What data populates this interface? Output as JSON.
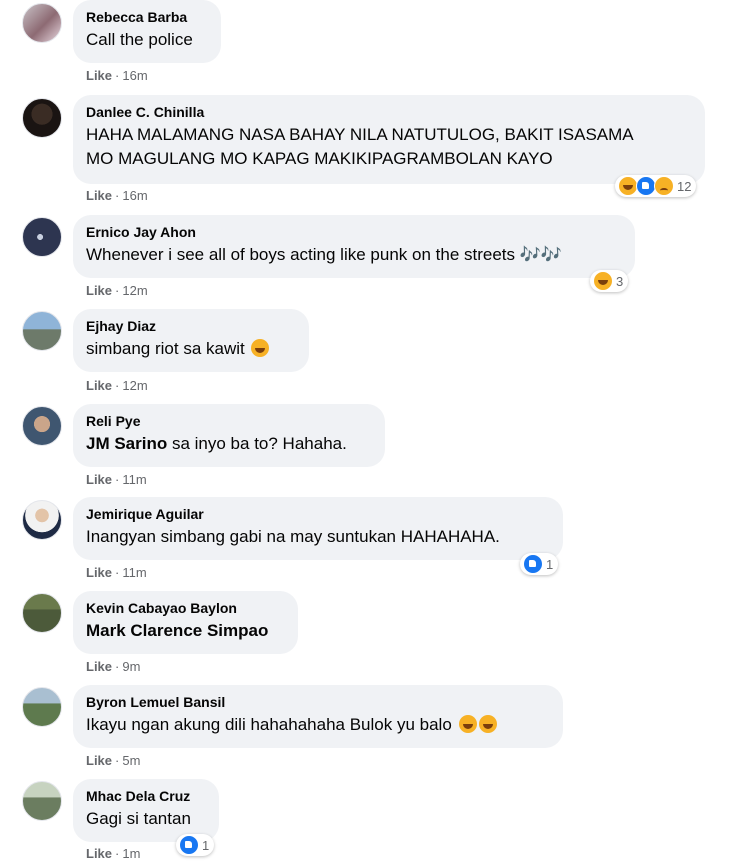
{
  "comments": [
    {
      "author": "Rebecca Barba",
      "text": "Call the police",
      "like": "Like",
      "time": "16m"
    },
    {
      "author": "Danlee C. Chinilla",
      "line1": "HAHA MALAMANG NASA BAHAY NILA NATUTULOG, BAKIT ISASAMA",
      "line2": "MO MAGULANG MO KAPAG MAKIKIPAGRAMBOLAN KAYO",
      "like": "Like",
      "time": "16m",
      "reaction_count": "12",
      "reactions": [
        "haha-icon",
        "like-icon",
        "sad-icon"
      ]
    },
    {
      "author": "Ernico Jay Ahon",
      "text": "Whenever i see all of boys acting like punk on the streets",
      "notes": "🎶🎶",
      "like": "Like",
      "time": "12m",
      "reaction_count": "3",
      "reactions": [
        "haha-icon"
      ]
    },
    {
      "author": "Ejhay Diaz",
      "text": "simbang riot sa kawit",
      "emoji": "rofl-emoji",
      "like": "Like",
      "time": "12m"
    },
    {
      "author": "Reli Pye",
      "mention": "JM Sarino",
      "text": " sa inyo ba to? Hahaha.",
      "like": "Like",
      "time": "11m"
    },
    {
      "author": "Jemirique Aguilar",
      "text": "Inangyan simbang gabi na may suntukan HAHAHAHA.",
      "like": "Like",
      "time": "11m",
      "reaction_count": "1",
      "reactions": [
        "like-icon"
      ]
    },
    {
      "author": "Kevin Cabayao Baylon",
      "mention": "Mark Clarence Simpao",
      "like": "Like",
      "time": "9m"
    },
    {
      "author": "Byron Lemuel Bansil",
      "text": "Ikayu ngan akung dili hahahahaha Bulok yu balo",
      "emoji": "joy-emoji",
      "like": "Like",
      "time": "5m"
    },
    {
      "author": "Mhac Dela Cruz",
      "text": "Gagi si tantan",
      "like": "Like",
      "time": "1m",
      "reaction_count": "1",
      "reactions": [
        "like-icon"
      ]
    }
  ],
  "colors": {
    "bubble": "#f0f2f5",
    "meta": "#65676b",
    "like_blue": "#1877f2",
    "haha_yellow": "#f7b125"
  }
}
